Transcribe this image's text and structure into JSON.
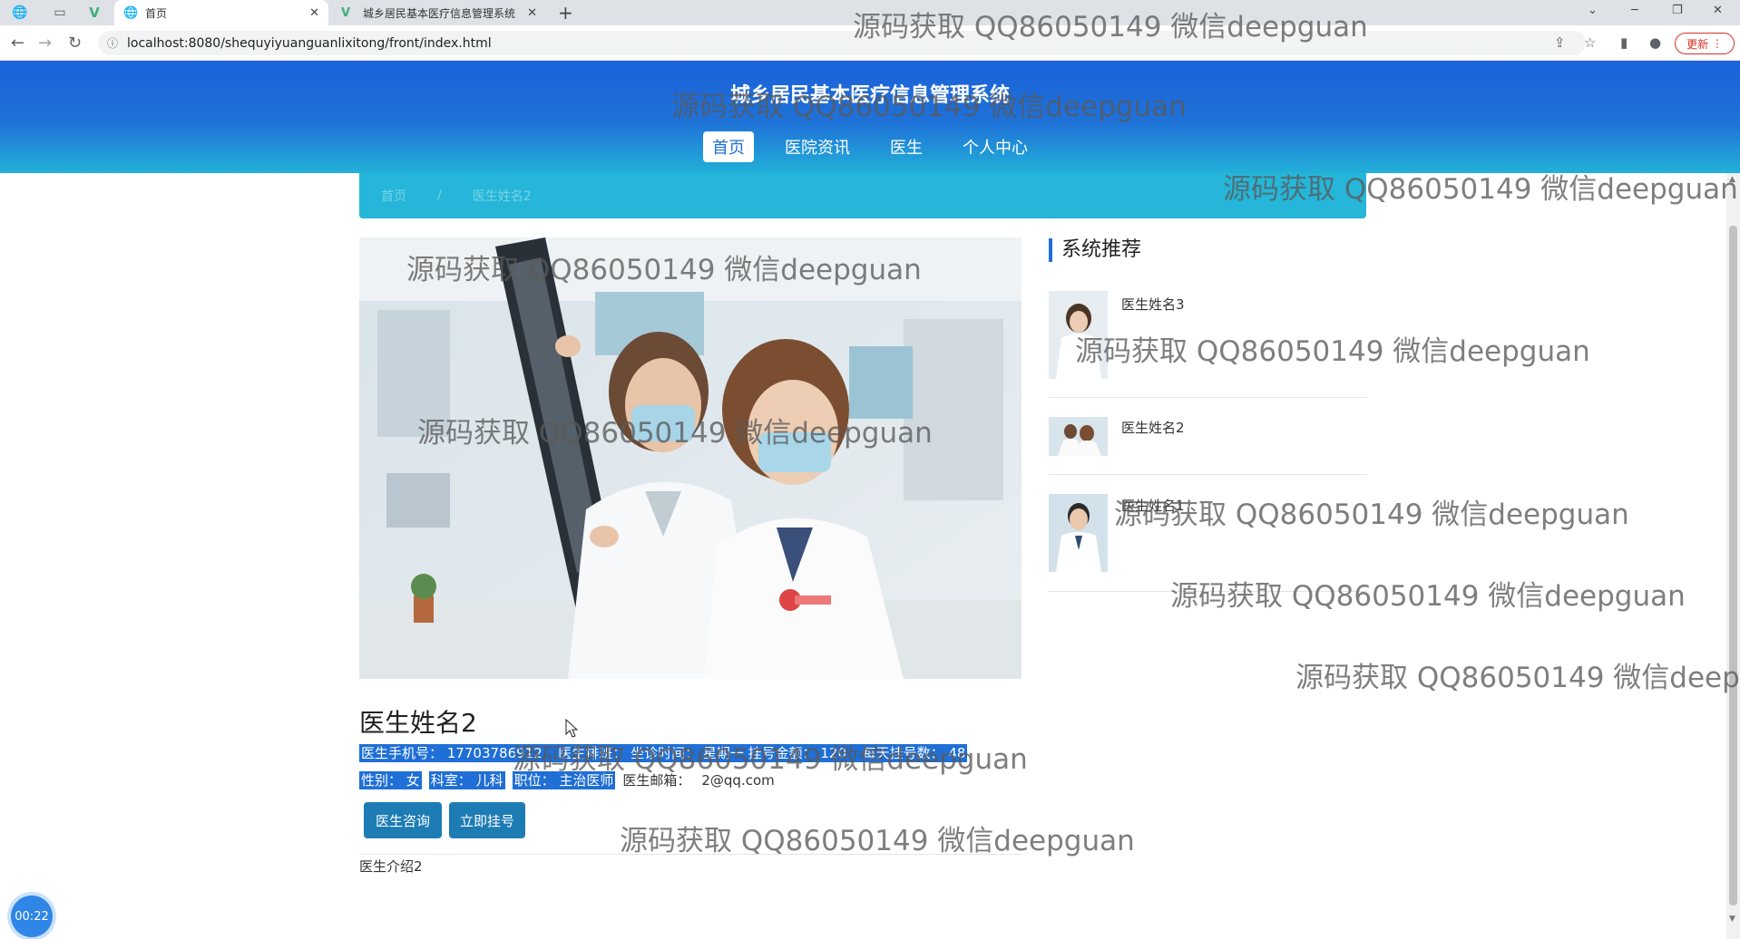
{
  "browser": {
    "tabs": [
      {
        "title": "首页",
        "icon": "globe-icon"
      },
      {
        "title": "城乡居民基本医疗信息管理系统",
        "icon": "vue-logo-icon"
      }
    ],
    "new_tab": "+",
    "url": "localhost:8080/shequyiyuanguanlixitong/front/index.html",
    "update_label": "更新"
  },
  "site": {
    "title": "城乡居民基本医疗信息管理系统",
    "nav": [
      "首页",
      "医院资讯",
      "医生",
      "个人中心"
    ],
    "active_nav": "首页"
  },
  "breadcrumb": {
    "home": "首页",
    "separator": "/",
    "current": "医生姓名2"
  },
  "doctor": {
    "name": "医生姓名2",
    "phone": "医生手机号：  17703786912",
    "schedule": "医生排班：  坐诊时间：  星期一  挂号金额：  120",
    "daily_limit": "每天挂号数：  48",
    "gender": "性别：  女",
    "department": "科室：  儿科",
    "position": "职位：  主治医师",
    "email_label": "医生邮箱：",
    "email": "2@qq.com",
    "consult_button": "医生咨询",
    "register_button": "立即挂号",
    "intro": "医生介绍2"
  },
  "sidebar": {
    "title": "系统推荐",
    "items": [
      {
        "name": "医生姓名3"
      },
      {
        "name": "医生姓名2"
      },
      {
        "name": "医生姓名1"
      }
    ]
  },
  "watermark_text": "源码获取 QQ86050149 微信deepguan",
  "timer": "00:22",
  "colors": {
    "header_top": "#1c61d9",
    "header_bottom": "#22b0d8",
    "button": "#1e7cb4",
    "selection": "#1f6fd6"
  }
}
